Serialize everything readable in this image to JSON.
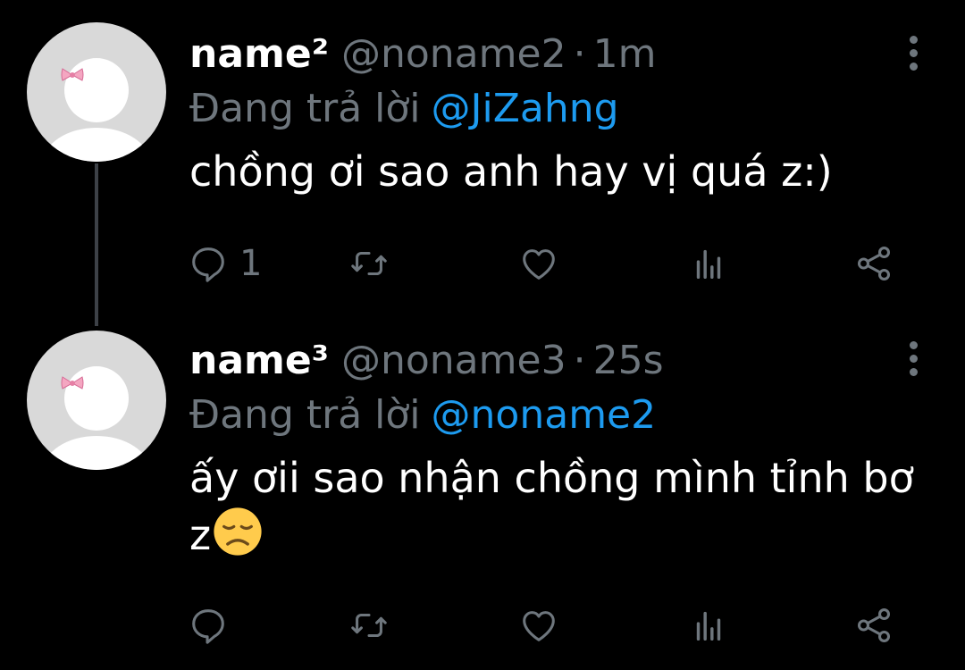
{
  "colors": {
    "background": "#000000",
    "text_primary": "#ffffff",
    "text_secondary": "#6e767d",
    "mention": "#1d9bf0",
    "thread_line": "#3d4147",
    "avatar_bg": "#d9d9d9"
  },
  "tweets": [
    {
      "display_name": "name²",
      "handle": "@noname2",
      "separator": "·",
      "time": "1m",
      "reply_prefix": "Đang trả lời",
      "reply_to": "@JiZahng",
      "text": "chồng ơi sao anh hay vị quá z:)",
      "emoji": "",
      "reply_count": "1",
      "icons": [
        "reply-icon",
        "retweet-icon",
        "like-icon",
        "analytics-icon",
        "share-icon",
        "more-icon"
      ]
    },
    {
      "display_name": "name³",
      "handle": "@noname3",
      "separator": "·",
      "time": "25s",
      "reply_prefix": "Đang trả lời",
      "reply_to": "@noname2",
      "text": "ấy ơii sao nhận chồng mình tỉnh bơ z",
      "emoji": "disappointed-face",
      "reply_count": "",
      "icons": [
        "reply-icon",
        "retweet-icon",
        "like-icon",
        "analytics-icon",
        "share-icon",
        "more-icon"
      ]
    }
  ]
}
